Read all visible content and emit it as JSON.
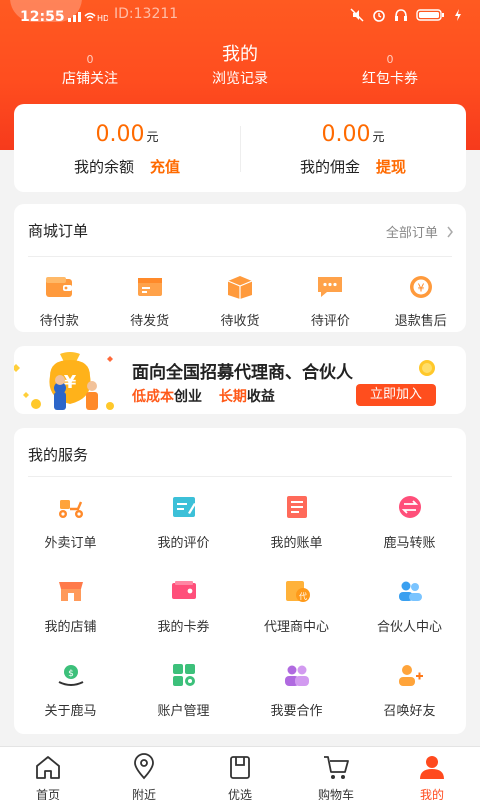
{
  "status_bar": {
    "time": "12:55",
    "signal": "4G",
    "network": "HD",
    "id_text": "ID:13211"
  },
  "header": {
    "title": "我的",
    "stats": [
      {
        "count": "0",
        "label": "店铺关注"
      },
      {
        "count": "",
        "label": "浏览记录"
      },
      {
        "count": "0",
        "label": "红包卡券"
      }
    ]
  },
  "balance": {
    "left": {
      "amount": "0.00",
      "unit": "元",
      "label": "我的余额",
      "action": "充值"
    },
    "right": {
      "amount": "0.00",
      "unit": "元",
      "label": "我的佣金",
      "action": "提现"
    }
  },
  "orders": {
    "title": "商城订单",
    "all_label": "全部订单",
    "items": [
      "待付款",
      "待发货",
      "待收货",
      "待评价",
      "退款售后"
    ]
  },
  "banner": {
    "line1": "面向全国招募代理商、合伙人",
    "line2_a": "低成本",
    "line2_b": "创业",
    "line2_c": "长期",
    "line2_d": "收益",
    "button": "立即加入"
  },
  "services": {
    "title": "我的服务",
    "rows": [
      [
        "外卖订单",
        "我的评价",
        "我的账单",
        "鹿马转账"
      ],
      [
        "我的店铺",
        "我的卡券",
        "代理商中心",
        "合伙人中心"
      ],
      [
        "关于鹿马",
        "账户管理",
        "我要合作",
        "召唤好友"
      ]
    ]
  },
  "tabbar": {
    "items": [
      "首页",
      "附近",
      "优选",
      "购物车",
      "我的"
    ],
    "active_index": 4
  },
  "colors": {
    "accent": "#ff4a1e",
    "orange": "#ff6a00"
  }
}
